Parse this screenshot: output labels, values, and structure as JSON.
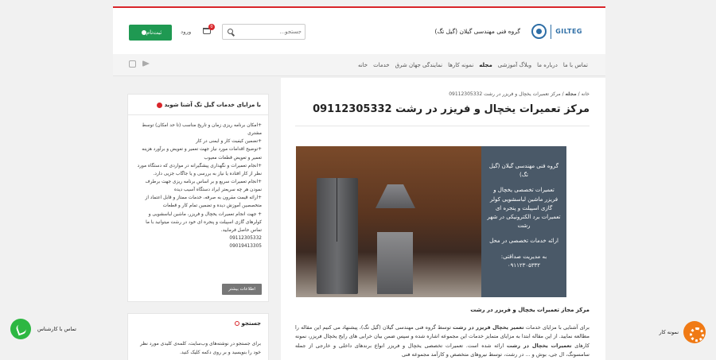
{
  "header": {
    "logo_text": "GILTEG",
    "site_name": "گروه فنی مهندسی گیلان (گیل تگ)",
    "search_placeholder": "جستجو...",
    "cart_count": "0",
    "login_label": "ورود",
    "register_label": "ثبت‌نام"
  },
  "nav": {
    "items": [
      "خانه",
      "خدمات",
      "نمایندگی جهان شرق",
      "نمونه کارها",
      "مجله",
      "وبلاگ آموزشی",
      "درباره ما",
      "تماس با ما"
    ],
    "active_index": 4
  },
  "social": [
    "instagram-icon",
    "telegram-icon"
  ],
  "main": {
    "breadcrumb_home": "خانه",
    "breadcrumb_sep": "/",
    "breadcrumb_section": "مجله",
    "breadcrumb_current": "مرکز تعمیرات یخچال و فریزر در رشت 09112305332",
    "title": "مرکز تعمیرات یخچال و فریزر در رشت 09112305332",
    "image_panel": {
      "line1": "گروه فنی مهندسی گیلان (گیل تگ)",
      "line2": "تعمیرات تخصصی یخچال و فریزر ماشین لباسشویی کولر گازی اسپیلت و پنجره ای تعمیرات برد الکترونیکی در شهر رشت",
      "line3": "ارائه خدمات تخصصی در محل",
      "line4": "به مدیریت صداقتی: ۰۹۱۱۲۳۰۵۳۳۲"
    },
    "caption": "مرکز مجاز تعمیرات یخچال و فریزر در رشت",
    "body_1": "برای آشنایی با مزایای خدمات ",
    "body_bold_1": "تعمیر یخچال فریزر در رشت",
    "body_2": " توسط گروه فنی مهندسی گیلان (گیل تگ)، پیشنهاد می کنیم این مقاله را مطالعه نمایید. از این مقاله ابتدا به مزایای متمایز خدمات این مجموعه اشاره شده و سپس ضمن بیان خرابی های رایج یخچال فریزر، نمونه کارهای ",
    "body_bold_2": "تعمیرات یخچال در رشت",
    "body_3": " ارائه شده است. تعمیرات تخصصی یخچال و فریزر انواع برندهای داخلی و خارجی از جمله سامسونگ، ال جی، بوش و ... در رشت، توسط نیروهای متخصص و کارآمد مجموعه فنی"
  },
  "widget_features": {
    "title": "با مزایای خدمات گیل تگ آشنا شوید",
    "items": [
      "+امکان برنامه ریزی زمان و تاریخ مناسب (تا حد امکان) توسط مشتری",
      "+تضمین کیفیت کار و ایمنی در کار",
      "+توضیح اقدامات مورد نیاز جهت تعمیر و تعویض و برآورد هزینه تعمیر و تعویض قطعات معیوب",
      "+انجام تعمیرات و نگهداری پیشگیرانه در مواردی که دستگاه مورد نظر از کار افتاده یا نیاز به بررسی و یا جاگاب جزیی دارد.",
      "+انجام تعمیرات سریع و بر اساس برنامه ریزی جهت برطرف نمودن هر چه سریعتر ایراد دستگاه آسیب دیده",
      "+ارائه قیمت مقرون به صرفه، خدمات ممتاز و قابل اعتماد از متخصصین آموزش دیده و تضمین تمام کار و قطعات",
      "+ جهت انجام تعمیرات یخچال و فریزر، ماشین لباسشویی و کولرهای گازی اسپیلت و پنجره ای خود در رشت میتوانید با ما تماس حاصل فرمایید.",
      "09112305332",
      "09019413305"
    ],
    "more_label": "اطلاعات بیشتر"
  },
  "widget_search": {
    "title": "جستجو",
    "text": "برای جستجو در نوشته‌های وب‌سایت، کلمه‌ی کلیدی مورد نظر خود را بنویسید و بر روی دکمه کلیک کنید."
  },
  "float": {
    "call_label": "تماس با کارشناس",
    "sample_label": "نمونه کار"
  },
  "colors": {
    "accent_red": "#d9262b",
    "brand_blue": "#2e6ea6",
    "register_green": "#1f9952",
    "call_green": "#2db742",
    "orange": "#f07a15"
  }
}
